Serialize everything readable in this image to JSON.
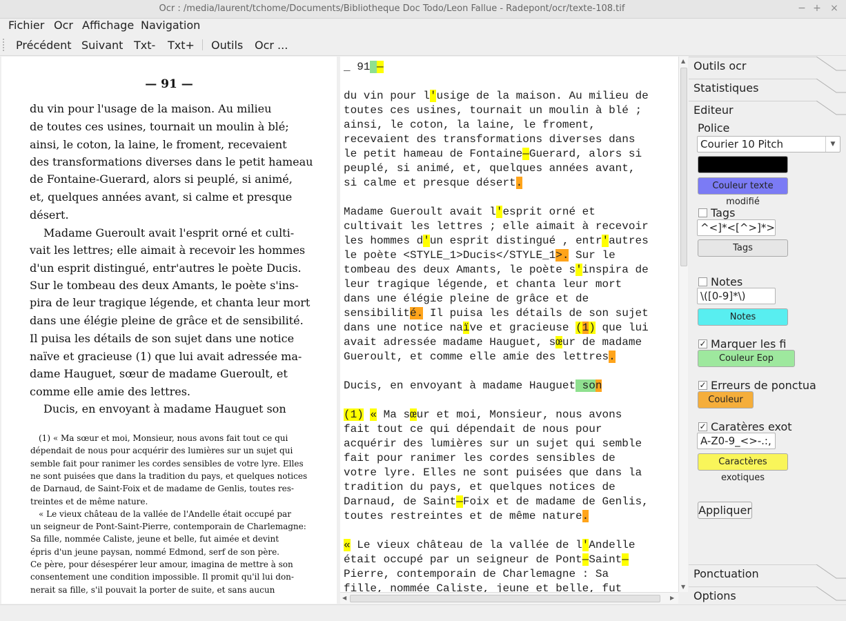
{
  "window": {
    "title": "Ocr : /media/laurent/tchome/Documents/Bibliotheque Doc Todo/Leon Fallue - Radepont/ocr/texte-108.tif",
    "min": "−",
    "max": "+",
    "close": "×"
  },
  "menu": [
    "Fichier",
    "Ocr",
    "Affichage",
    "Navigation"
  ],
  "toolbar": [
    "Précédent",
    "Suivant",
    "Txt-",
    "Txt+",
    "Outils",
    "Ocr ..."
  ],
  "scan": {
    "page_number": "— 91 —",
    "lines": [
      "du vin pour l'usage de la maison. Au milieu",
      "de toutes ces usines, tournait un moulin à blé;",
      "ainsi, le coton, la laine, le froment, recevaient",
      "des transformations diverses dans le petit hameau",
      "de Fontaine-Guerard, alors si peuplé, si animé,",
      "et, quelques années avant, si calme et presque",
      "désert.",
      "Madame Gueroult avait l'esprit orné et culti-",
      "vait les lettres; elle aimait à recevoir les hommes",
      "d'un esprit distingué, entr'autres le poète Ducis.",
      "Sur le tombeau des deux Amants, le poète s'ins-",
      "pira de leur tragique légende, et chanta leur mort",
      "dans une élégie pleine de grâce et de sensibilité.",
      "Il puisa les détails de son sujet dans une notice",
      "naïve et gracieuse (1) que lui avait adressée ma-",
      "dame Hauguet, sœur de madame Gueroult, et",
      "comme elle amie des lettres.",
      "Ducis, en envoyant à madame Hauguet son"
    ],
    "footnotes": [
      "(1) « Ma sœur et moi, Monsieur, nous avons fait tout ce qui",
      "dépendait de nous pour acquérir des lumières sur un sujet qui",
      "semble fait pour ranimer les cordes sensibles de votre lyre. Elles",
      "ne sont puisées que dans la tradition du pays, et quelques notices",
      "de Darnaud, de Saint-Foix et de madame de Genlis, toutes res-",
      "treintes et de même nature.",
      "« Le vieux château de la vallée de l'Andelle était occupé par",
      "un seigneur de Pont-Saint-Pierre, contemporain de Charlemagne:",
      "Sa fille, nommée Caliste, jeune et belle, fut aimée et devint",
      "épris d'un jeune paysan, nommé Edmond, serf de son père.",
      "Ce père, pour désespérer leur amour, imagina de mettre à son",
      "consentement une condition impossible. Il promit qu'il lui don-",
      "nerait sa fille, s'il pouvait la porter de suite, et sans aucun"
    ]
  },
  "editor": {
    "lines": [
      [
        {
          "t": "_ 91"
        },
        {
          "t": " ",
          "h": "g"
        },
        {
          "t": "—",
          "h": "y"
        }
      ],
      [],
      [
        {
          "t": "du vin pour l"
        },
        {
          "t": "'",
          "h": "y"
        },
        {
          "t": "usige de la maison. Au milieu de"
        }
      ],
      [
        {
          "t": "toutes ces usines, tournait un moulin à blé ;"
        }
      ],
      [
        {
          "t": "ainsi, le coton, la laine, le froment,"
        }
      ],
      [
        {
          "t": "recevaient des transformations diverses dans"
        }
      ],
      [
        {
          "t": "le petit hameau de Fontaine"
        },
        {
          "t": "—",
          "h": "y"
        },
        {
          "t": "Guerard, alors si"
        }
      ],
      [
        {
          "t": "peuplé, si animé, et, quelques années avant,"
        }
      ],
      [
        {
          "t": "si calme et presque désert"
        },
        {
          "t": ".",
          "h": "o"
        }
      ],
      [],
      [
        {
          "t": "Madame Gueroult avait l"
        },
        {
          "t": "'",
          "h": "y"
        },
        {
          "t": "esprit orné et"
        }
      ],
      [
        {
          "t": "cultivait les lettres ; elle aimait à recevoir"
        }
      ],
      [
        {
          "t": "les hommes d"
        },
        {
          "t": "'",
          "h": "y"
        },
        {
          "t": "un esprit distingué , entr"
        },
        {
          "t": "'",
          "h": "y"
        },
        {
          "t": "autres"
        }
      ],
      [
        {
          "t": "le poète <STYLE_1>Ducis</STYLE_1"
        },
        {
          "t": ">.",
          "h": "o"
        },
        {
          "t": " Sur le"
        }
      ],
      [
        {
          "t": "tombeau des deux Amants, le poète s"
        },
        {
          "t": "'",
          "h": "y"
        },
        {
          "t": "inspira de"
        }
      ],
      [
        {
          "t": "leur tragique légende, et chanta leur mort"
        }
      ],
      [
        {
          "t": "dans une élégie pleine de grâce et de"
        }
      ],
      [
        {
          "t": "sensibilit"
        },
        {
          "t": "é.",
          "h": "o"
        },
        {
          "t": " Il puisa les détails de son sujet"
        }
      ],
      [
        {
          "t": "dans une notice na"
        },
        {
          "t": "ï",
          "h": "y"
        },
        {
          "t": "ve et gracieuse "
        },
        {
          "t": "(",
          "h": "y"
        },
        {
          "t": "1",
          "h": "o"
        },
        {
          "t": ")",
          "h": "y"
        },
        {
          "t": " que lui"
        }
      ],
      [
        {
          "t": "avait adressée madame Hauguet, s"
        },
        {
          "t": "œ",
          "h": "y"
        },
        {
          "t": "ur de madame"
        }
      ],
      [
        {
          "t": "Gueroult, et comme elle amie des lettres"
        },
        {
          "t": ".",
          "h": "o"
        }
      ],
      [],
      [
        {
          "t": "Ducis, en envoyant à madame Hauguet"
        },
        {
          "t": " so",
          "h": "g"
        },
        {
          "t": "n",
          "h": "o"
        }
      ],
      [],
      [
        {
          "t": "(1)",
          "h": "y"
        },
        {
          "t": " "
        },
        {
          "t": "«",
          "h": "y"
        },
        {
          "t": " Ma s"
        },
        {
          "t": "œ",
          "h": "y"
        },
        {
          "t": "ur et moi, Monsieur, nous avons"
        }
      ],
      [
        {
          "t": "fait tout ce qui dépendait de nous pour"
        }
      ],
      [
        {
          "t": "acquérir des lumières sur un sujet qui semble"
        }
      ],
      [
        {
          "t": "fait pour ranimer les cordes sensibles de"
        }
      ],
      [
        {
          "t": "votre lyre. Elles ne sont puisées que dans la"
        }
      ],
      [
        {
          "t": "tradition du pays, et quelques notices de"
        }
      ],
      [
        {
          "t": "Darnaud, de Saint"
        },
        {
          "t": "—",
          "h": "y"
        },
        {
          "t": "Foix et de madame de Genlis,"
        }
      ],
      [
        {
          "t": "toutes restreintes et de même nature"
        },
        {
          "t": ".",
          "h": "o"
        }
      ],
      [],
      [
        {
          "t": "«",
          "h": "y"
        },
        {
          "t": " Le vieux château de la vallée de l"
        },
        {
          "t": "'",
          "h": "y"
        },
        {
          "t": "Andelle"
        }
      ],
      [
        {
          "t": "était occupé par un seigneur de Pont"
        },
        {
          "t": "—",
          "h": "y"
        },
        {
          "t": "Saint"
        },
        {
          "t": "—",
          "h": "y"
        }
      ],
      [
        {
          "t": "Pierre, contemporain de Charlemagne : Sa"
        }
      ],
      [
        {
          "t": "fille, nommée Caliste, jeune et belle, fut"
        }
      ]
    ]
  },
  "side": {
    "tabs": {
      "outils_ocr": "Outils ocr",
      "statistiques": "Statistiques",
      "editeur": "Editeur",
      "ponctuation": "Ponctuation",
      "options": "Options"
    },
    "police_label": "Police",
    "font_select": "Courier 10 Pitch",
    "color_swatch": "#000000",
    "modified_color_button": "Couleur texte modifié",
    "tags_label": "Tags",
    "tags_regex": "^<]*<[^>]*>",
    "tags_button": "Tags",
    "notes_label": "Notes",
    "notes_regex": "\\([0-9]*\\)",
    "notes_button": "Notes",
    "eop_label": "Marquer les fi",
    "eop_button": "Couleur Eop",
    "punct_label": "Erreurs de ponctua",
    "punct_button": "Couleur",
    "exotic_label": "Caratères exot",
    "exotic_regex": "A-Z0-9_<>-.:, ]",
    "exotic_button": "Caractères exotiques",
    "apply_button": "Appliquer",
    "checks": {
      "tags": false,
      "notes": false,
      "eop": true,
      "punct": true,
      "exotic": true
    },
    "colors": {
      "modified": "#7b7bf5",
      "notes": "#58eef0",
      "eop": "#9ee89e",
      "punct": "#f5ae3b",
      "exotic": "#f9f55a"
    }
  }
}
